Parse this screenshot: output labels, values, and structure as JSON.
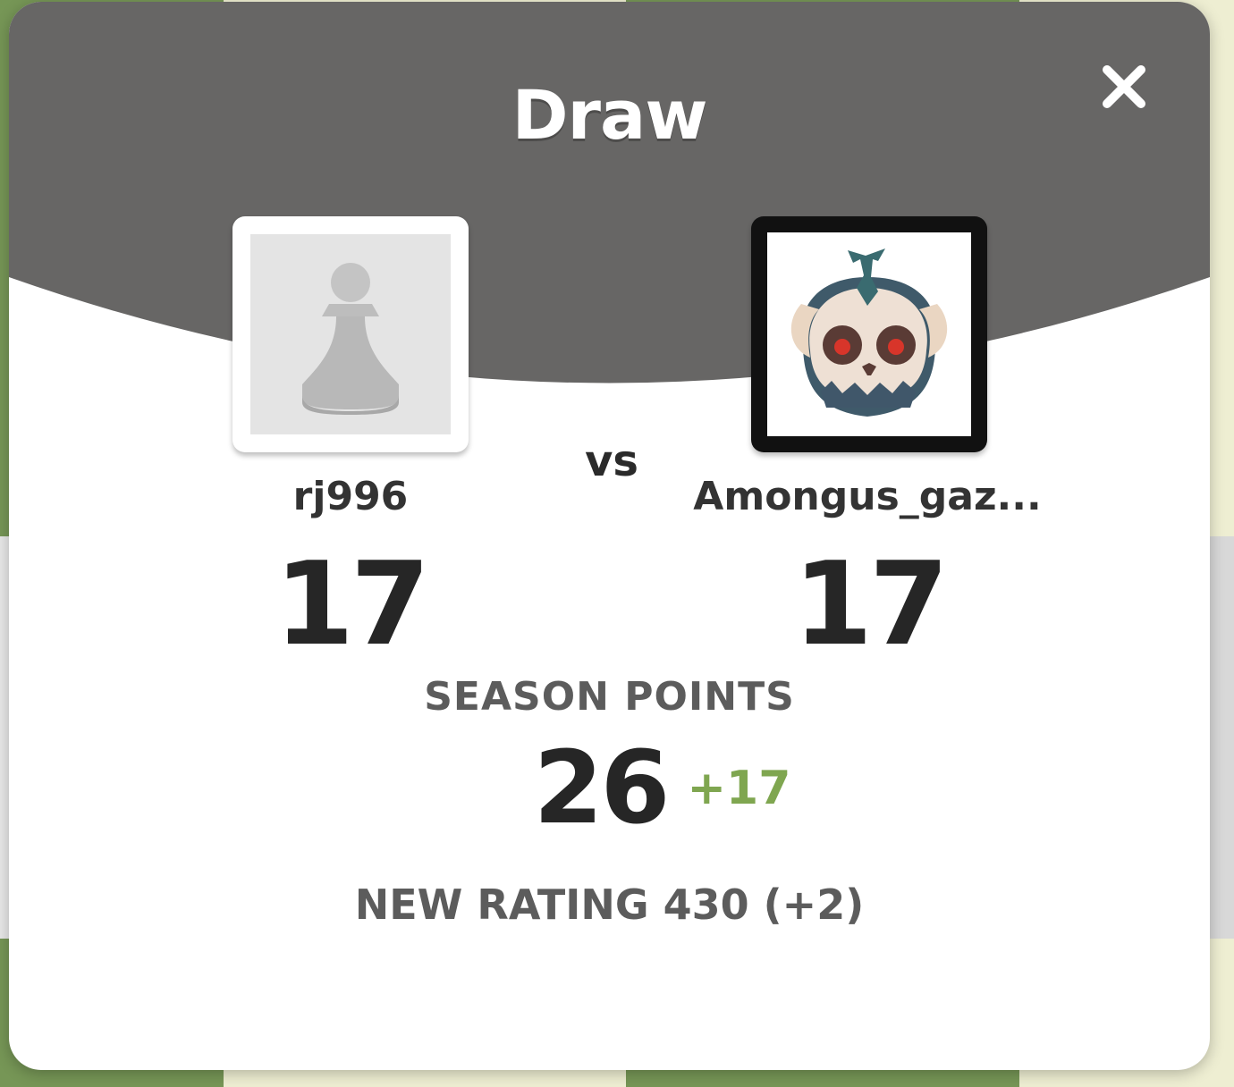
{
  "modal": {
    "title": "Draw",
    "close_icon": "close-icon",
    "header_color": "#676665"
  },
  "players": {
    "left": {
      "username": "rj996",
      "rating": "17",
      "avatar_icon": "pawn-icon"
    },
    "vs_label": "vs",
    "right": {
      "username": "Amongus_gaz...",
      "rating": "17",
      "avatar_icon": "skull-monster-avatar"
    }
  },
  "season": {
    "label": "SEASON POINTS",
    "value": "26",
    "delta": "+17",
    "delta_color": "#7fa650"
  },
  "new_rating": {
    "text": "NEW RATING 430 (+2)"
  }
}
